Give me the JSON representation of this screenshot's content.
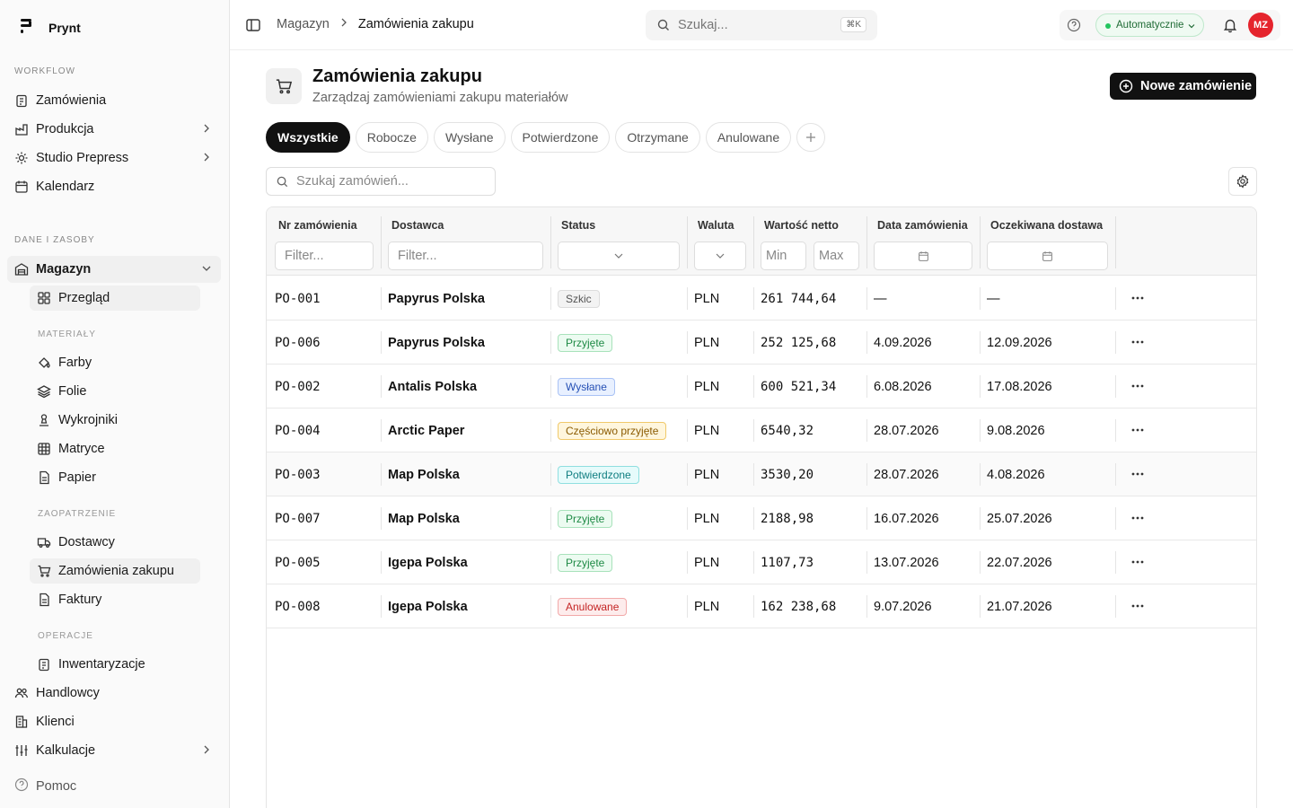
{
  "app": {
    "name": "Prynt"
  },
  "sidebar": {
    "sections": {
      "workflow": "WORKFLOW",
      "dane": "DANE I ZASOBY"
    },
    "subsections": {
      "materialy": "MATERIAŁY",
      "zaopatrzenie": "ZAOPATRZENIE",
      "operacje": "OPERACJE"
    },
    "items": {
      "zamowienia": "Zamówienia",
      "produkcja": "Produkcja",
      "studio": "Studio Prepress",
      "kalendarz": "Kalendarz",
      "magazyn": "Magazyn",
      "przeglad": "Przegląd",
      "farby": "Farby",
      "folie": "Folie",
      "wykrojniki": "Wykrojniki",
      "matryce": "Matryce",
      "papier": "Papier",
      "dostawcy": "Dostawcy",
      "zamowienia_zakupu": "Zamówienia zakupu",
      "faktury": "Faktury",
      "inwentaryzacje": "Inwentaryzacje",
      "handlowcy": "Handlowcy",
      "klienci": "Klienci",
      "kalkulacje": "Kalkulacje"
    },
    "help": "Pomoc"
  },
  "topbar": {
    "breadcrumb": [
      "Magazyn",
      "Zamówienia zakupu"
    ],
    "search_placeholder": "Szukaj...",
    "search_shortcut": "⌘K",
    "mode": "Automatycznie",
    "avatar": "MZ"
  },
  "page": {
    "title": "Zamówienia zakupu",
    "subtitle": "Zarządzaj zamówieniami zakupu materiałów",
    "new_button": "Nowe zamówienie"
  },
  "tabs": [
    "Wszystkie",
    "Robocze",
    "Wysłane",
    "Potwierdzone",
    "Otrzymane",
    "Anulowane"
  ],
  "table_search_placeholder": "Szukaj zamówień...",
  "table": {
    "columns": {
      "nr": "Nr zamówienia",
      "dostawca": "Dostawca",
      "status": "Status",
      "waluta": "Waluta",
      "wartosc": "Wartość netto",
      "data": "Data zamówienia",
      "dostawa": "Oczekiwana dostawa"
    },
    "filters": {
      "nr": "Filter...",
      "dostawca": "Filter...",
      "min": "Min",
      "max": "Max"
    },
    "rows": [
      {
        "nr": "PO-001",
        "dostawca": "Papyrus Polska",
        "status": "Szkic",
        "waluta": "PLN",
        "wartosc": "261 744,64",
        "data": "—",
        "dostawa": "—"
      },
      {
        "nr": "PO-006",
        "dostawca": "Papyrus Polska",
        "status": "Przyjęte",
        "waluta": "PLN",
        "wartosc": "252 125,68",
        "data": "4.09.2026",
        "dostawa": "12.09.2026"
      },
      {
        "nr": "PO-002",
        "dostawca": "Antalis Polska",
        "status": "Wysłane",
        "waluta": "PLN",
        "wartosc": "600 521,34",
        "data": "6.08.2026",
        "dostawa": "17.08.2026"
      },
      {
        "nr": "PO-004",
        "dostawca": "Arctic Paper",
        "status": "Częściowo przyjęte",
        "waluta": "PLN",
        "wartosc": "6540,32",
        "data": "28.07.2026",
        "dostawa": "9.08.2026"
      },
      {
        "nr": "PO-003",
        "dostawca": "Map Polska",
        "status": "Potwierdzone",
        "waluta": "PLN",
        "wartosc": "3530,20",
        "data": "28.07.2026",
        "dostawa": "4.08.2026"
      },
      {
        "nr": "PO-007",
        "dostawca": "Map Polska",
        "status": "Przyjęte",
        "waluta": "PLN",
        "wartosc": "2188,98",
        "data": "16.07.2026",
        "dostawa": "25.07.2026"
      },
      {
        "nr": "PO-005",
        "dostawca": "Igepa Polska",
        "status": "Przyjęte",
        "waluta": "PLN",
        "wartosc": "1107,73",
        "data": "13.07.2026",
        "dostawa": "22.07.2026"
      },
      {
        "nr": "PO-008",
        "dostawca": "Igepa Polska",
        "status": "Anulowane",
        "waluta": "PLN",
        "wartosc": "162 238,68",
        "data": "9.07.2026",
        "dostawa": "21.07.2026"
      }
    ]
  },
  "status_colors": {
    "Szkic": {
      "bg": "#f3f3f3",
      "border": "#dcdcdc",
      "fg": "#555555"
    },
    "Przyjęte": {
      "bg": "#ecfbf1",
      "border": "#a8e2bb",
      "fg": "#1e8a45"
    },
    "Wysłane": {
      "bg": "#e8f0ff",
      "border": "#a9c2f5",
      "fg": "#2650b5"
    },
    "Częściowo przyjęte": {
      "bg": "#fff6dd",
      "border": "#f0c96a",
      "fg": "#8a5a00"
    },
    "Potwierdzone": {
      "bg": "#e6fbfb",
      "border": "#8fdfe0",
      "fg": "#0f7d80"
    },
    "Anulowane": {
      "bg": "#fdecec",
      "border": "#f2a9a9",
      "fg": "#c42424"
    }
  }
}
